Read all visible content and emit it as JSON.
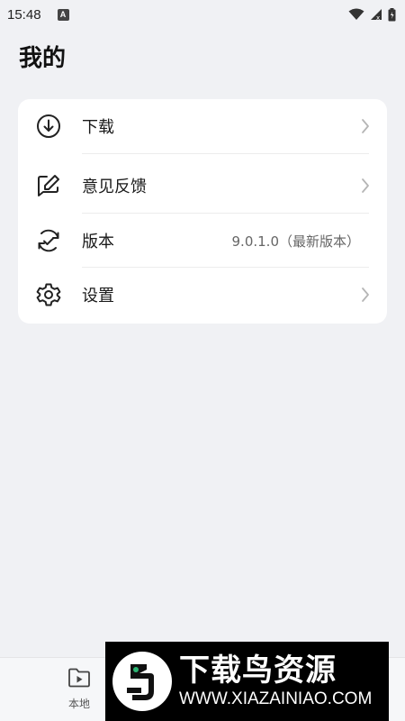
{
  "status_bar": {
    "time": "15:48",
    "notification_icon": "a-letter-icon",
    "icons": [
      "wifi-icon",
      "signal-icon",
      "battery-icon"
    ]
  },
  "page": {
    "title": "我的"
  },
  "menu": {
    "items": [
      {
        "icon": "download-icon",
        "label": "下载",
        "value": "",
        "has_chevron": true
      },
      {
        "icon": "edit-feedback-icon",
        "label": "意见反馈",
        "value": "",
        "has_chevron": true
      },
      {
        "icon": "version-check-icon",
        "label": "版本",
        "value": "9.0.1.0（最新版本）",
        "has_chevron": false
      },
      {
        "icon": "gear-icon",
        "label": "设置",
        "value": "",
        "has_chevron": true
      }
    ]
  },
  "bottom_nav": {
    "items": [
      {
        "icon": "local-video-folder-icon",
        "label": "本地"
      }
    ]
  },
  "watermark": {
    "title": "下载鸟资源",
    "url": "WWW.XIAZAINIAO.COM"
  },
  "colors": {
    "background": "#f0f1f4",
    "card": "#ffffff",
    "text_primary": "#1a1a1a",
    "text_secondary": "#666666"
  }
}
